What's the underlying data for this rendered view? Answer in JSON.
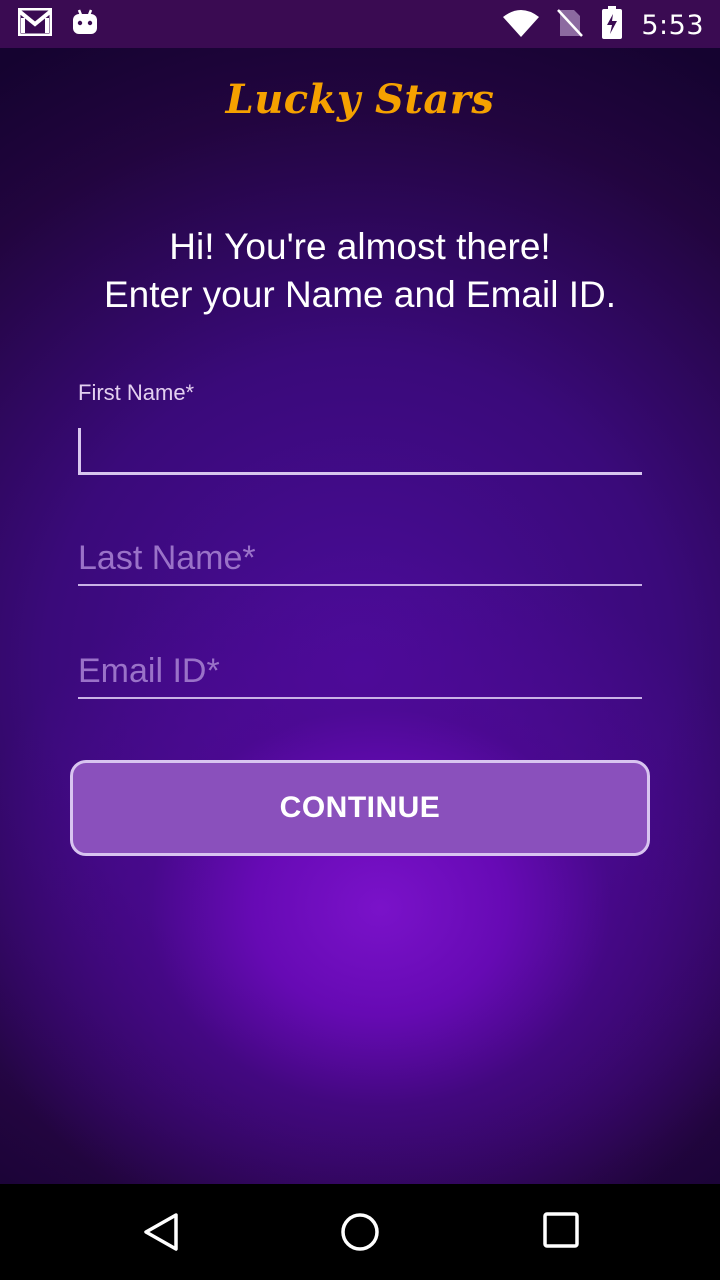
{
  "status_bar": {
    "time": "5:53",
    "icons": [
      "gmail-icon",
      "android-icon",
      "wifi-icon",
      "no-sim-icon",
      "battery-charging-icon"
    ]
  },
  "app": {
    "logo": "Lucky Stars",
    "intro_line1": "Hi! You're almost there!",
    "intro_line2": "Enter your Name and Email ID."
  },
  "form": {
    "first_name": {
      "label": "First Name*",
      "value": ""
    },
    "last_name": {
      "placeholder": "Last Name*",
      "value": ""
    },
    "email": {
      "placeholder": "Email ID*",
      "value": ""
    },
    "continue_label": "CONTINUE"
  },
  "nav_bar": {
    "icons": [
      "back-icon",
      "home-icon",
      "recents-icon"
    ]
  },
  "colors": {
    "logo": "#f5a100",
    "button": "#8a50bc",
    "status_bar": "#3a0b52"
  }
}
